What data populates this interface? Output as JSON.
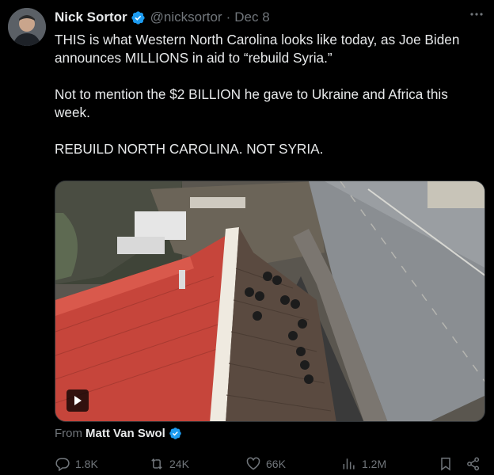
{
  "author": {
    "name": "Nick Sortor",
    "handle": "@nicksortor",
    "separator": "·",
    "date": "Dec 8"
  },
  "tweet": {
    "text": "THIS is what Western North Carolina looks like today, as Joe Biden announces MILLIONS in aid to “rebuild Syria.”\n\nNot to mention the $2 BILLION he gave to Ukraine and Africa this week.\n\nREBUILD NORTH CAROLINA. NOT SYRIA."
  },
  "media": {
    "from_label": "From",
    "from_name": "Matt Van Swol"
  },
  "actions": {
    "replies": "1.8K",
    "reposts": "24K",
    "likes": "66K",
    "views": "1.2M"
  },
  "colors": {
    "background": "#000000",
    "text": "#e7e9ea",
    "muted": "#71767b",
    "verified": "#1d9bf0"
  }
}
